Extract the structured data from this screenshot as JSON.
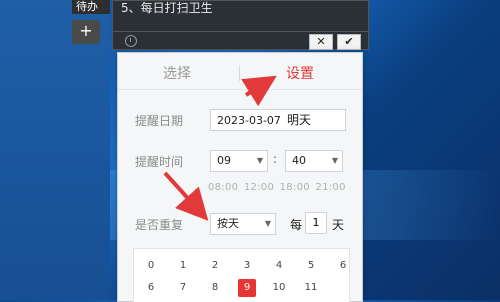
{
  "side": {
    "todo_label": "待办",
    "add_label": "+"
  },
  "note": {
    "text": "5、每日打扫卫生",
    "clock_icon": "clock-icon",
    "cancel_label": "✕",
    "confirm_label": "✔"
  },
  "reminder": {
    "tabs": {
      "select": "选择",
      "settings": "设置",
      "active": "settings"
    },
    "date": {
      "label": "提醒日期",
      "value": "2023-03-07",
      "hint": "明天"
    },
    "time": {
      "label": "提醒时间",
      "hour": "09",
      "minute": "40",
      "separator": ":"
    },
    "presets": [
      "08:00",
      "12:00",
      "18:00",
      "21:00"
    ],
    "repeat": {
      "label": "是否重复",
      "value": "按天",
      "each": "每",
      "count": "1",
      "unit": "天"
    },
    "grid": {
      "row1": [
        "0",
        "1",
        "2",
        "3",
        "4",
        "5",
        "6"
      ],
      "row2": [
        "6",
        "7",
        "8",
        "9",
        "10",
        "11"
      ],
      "selected": "9"
    },
    "accent": "#e23a3a"
  }
}
